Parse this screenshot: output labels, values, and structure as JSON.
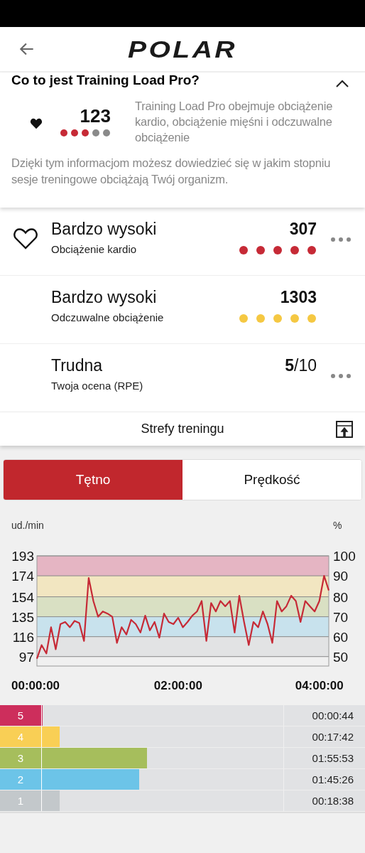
{
  "header": {
    "logo": "POLAR"
  },
  "info_card": {
    "heading": "Co to jest Training Load Pro?",
    "expanded": true,
    "score": "123",
    "stars": 3,
    "description": "Training Load Pro obejmuje obciążenie kardio, obciążenie mięśni i odczuwalne obciążenie",
    "note": "Dzięki tym informacjom możesz dowiedzieć się w jakim stopniu sesje treningowe obciążają Twój organizm."
  },
  "load_rows": [
    {
      "kind": "heart",
      "title": "Bardzo wysoki",
      "subtitle": "Obciążenie kardio",
      "value": "307",
      "value_bold": true,
      "stars": 5,
      "color": "#c62a36",
      "menu": true
    },
    {
      "kind": "plain",
      "title": "Bardzo wysoki",
      "subtitle": "Odczuwalne obciążenie",
      "value": "1303",
      "value_bold": true,
      "stars": 5,
      "color": "#f5c842",
      "menu": false
    },
    {
      "kind": "plain",
      "title": "Trudna",
      "subtitle": "Twoja ocena (RPE)",
      "value": "**5**/10",
      "value_bold": false,
      "menu": true
    }
  ],
  "zones_section": {
    "title": "Strefy treningu"
  },
  "tabs": [
    {
      "label": "Tętno",
      "selected": true
    },
    {
      "label": "Prędkość",
      "selected": false
    }
  ],
  "hr_chart": {
    "right_axis": {
      "label": "%",
      "ticks": [
        "100",
        "90",
        "80",
        "70",
        "60",
        "50"
      ]
    },
    "chart_data": {
      "type": "line",
      "ylabel": "ud./min",
      "xlim": [
        0,
        248
      ],
      "ylim": [
        88,
        193
      ],
      "yticks": [
        193,
        174,
        154,
        135,
        116,
        97
      ],
      "xticks": [
        {
          "value": 0,
          "label": "00:00:00"
        },
        {
          "value": 120,
          "label": "02:00:00"
        },
        {
          "value": 240,
          "label": "04:00:00"
        }
      ],
      "x": [
        0,
        4,
        8,
        12,
        16,
        20,
        24,
        28,
        32,
        36,
        40,
        44,
        48,
        52,
        56,
        60,
        64,
        68,
        72,
        76,
        80,
        84,
        88,
        92,
        96,
        100,
        104,
        108,
        112,
        116,
        120,
        124,
        128,
        132,
        136,
        140,
        144,
        148,
        152,
        156,
        160,
        164,
        168,
        172,
        176,
        180,
        184,
        188,
        192,
        196,
        200,
        204,
        208,
        212,
        216,
        220,
        224,
        228,
        232,
        236,
        240,
        244,
        248
      ],
      "grid": true,
      "series": [
        {
          "color": "#c62a36",
          "values": [
            95,
            108,
            100,
            125,
            104,
            128,
            130,
            125,
            131,
            129,
            112,
            172,
            150,
            135,
            140,
            138,
            135,
            110,
            125,
            118,
            132,
            128,
            120,
            136,
            122,
            130,
            115,
            138,
            130,
            128,
            134,
            125,
            130,
            136,
            140,
            150,
            112,
            148,
            140,
            150,
            145,
            150,
            120,
            155,
            130,
            108,
            130,
            125,
            140,
            128,
            110,
            150,
            140,
            145,
            155,
            150,
            130,
            150,
            145,
            140,
            150,
            174,
            160
          ]
        }
      ]
    }
  },
  "zones": [
    {
      "label": "5",
      "time": "00:00:44",
      "level": 0.15,
      "color": "#cd2e5c"
    },
    {
      "label": "4",
      "time": "00:17:42",
      "level": 0.21,
      "color": "#f9cf55"
    },
    {
      "label": "3",
      "time": "01:55:53",
      "level": 0.52,
      "color": "#a6be5c"
    },
    {
      "label": "2",
      "time": "01:45:26",
      "level": 0.49,
      "color": "#6cc4e8"
    },
    {
      "label": "1",
      "time": "00:18:38",
      "level": 0.21,
      "color": "#c3c8cb"
    }
  ]
}
